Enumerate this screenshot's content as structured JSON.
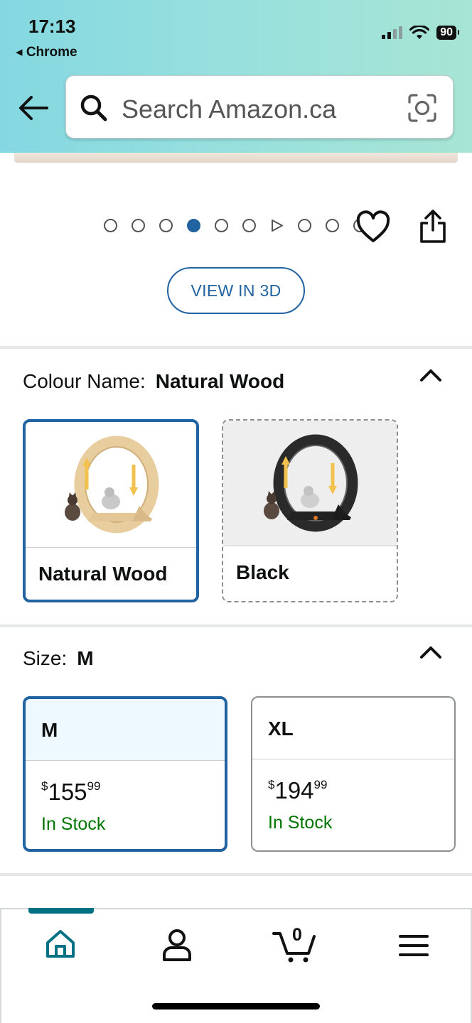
{
  "status_bar": {
    "time": "17:13",
    "back_app": "◂ Chrome",
    "battery": "90"
  },
  "search": {
    "placeholder": "Search Amazon.ca"
  },
  "carousel": {
    "dot_count": 10,
    "active_index": 3,
    "video_index": 6
  },
  "view_3d_label": "VIEW IN 3D",
  "colour": {
    "label": "Colour Name:",
    "selected": "Natural Wood",
    "options": [
      {
        "label": "Natural Wood",
        "selected": true,
        "available": true
      },
      {
        "label": "Black",
        "selected": false,
        "available": false
      }
    ]
  },
  "size": {
    "label": "Size:",
    "selected": "M",
    "options": [
      {
        "label": "M",
        "currency": "$",
        "price_whole": "155",
        "price_fraction": "99",
        "stock": "In Stock",
        "selected": true
      },
      {
        "label": "XL",
        "currency": "$",
        "price_whole": "194",
        "price_fraction": "99",
        "stock": "In Stock",
        "selected": false
      }
    ]
  },
  "bottom_nav": {
    "items": [
      "home-icon",
      "account-icon",
      "cart-icon",
      "menu-icon"
    ],
    "cart_count": "0"
  },
  "colors": {
    "accent_blue": "#2162a1",
    "in_stock_green": "#007600",
    "nav_active_teal": "#007185"
  }
}
